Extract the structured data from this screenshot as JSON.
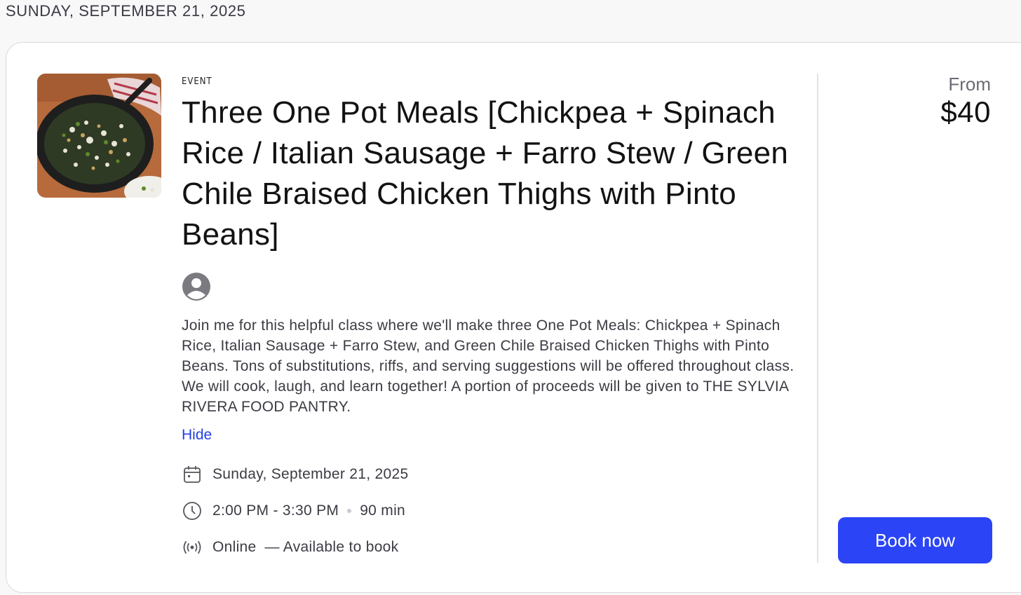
{
  "date_heading": "SUNDAY, SEPTEMBER 21, 2025",
  "event": {
    "eyebrow": "EVENT",
    "title": "Three One Pot Meals [Chickpea + Spinach Rice / Italian Sausage + Farro Stew / Green Chile Braised Chicken Thighs with Pinto Beans]",
    "thumbnail_icon": "food-photo-skillet",
    "avatar_icon": "user-avatar-icon",
    "description": "Join me for this helpful class where we'll make three One Pot Meals: Chickpea + Spinach Rice, Italian Sausage + Farro Stew, and Green Chile Braised Chicken Thighs with Pinto Beans. Tons of substitutions, riffs, and serving suggestions will be offered throughout class. We will cook, laugh, and learn together! A portion of proceeds will be given to THE SYLVIA RIVERA FOOD PANTRY.",
    "toggle_label": "Hide",
    "date": "Sunday, September 21, 2025",
    "time": "2:00 PM - 3:30 PM",
    "duration": "90 min",
    "location": "Online",
    "availability": "— Available to book"
  },
  "pricing": {
    "from_label": "From",
    "price": "$40"
  },
  "actions": {
    "book_label": "Book now"
  },
  "colors": {
    "accent": "#2b44f5",
    "link": "#2440e0",
    "muted_text": "#3b3b44"
  }
}
